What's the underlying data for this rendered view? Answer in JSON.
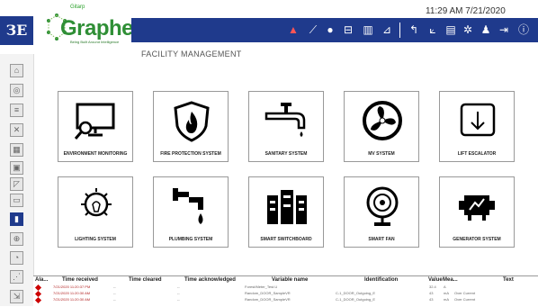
{
  "header": {
    "logo_text": "ЗЕ",
    "brand_small": "Gitarp",
    "brand": "Graphene",
    "tagline": "Being Built Around Intelligence",
    "clock": "11:29 AM  7/21/2020",
    "page_title": "FACILITY MANAGEMENT"
  },
  "toolbar_icons": [
    "alarm-bell-icon",
    "trend-chart-icon",
    "clock-icon",
    "server-icon",
    "bar-chart-icon",
    "report-chart-icon",
    "undo-icon",
    "line-chart-icon",
    "document-icon",
    "settings-gear-icon",
    "user-icon",
    "export-icon",
    "info-icon"
  ],
  "sidebar_icons": [
    "home-icon",
    "globe-icon",
    "document-icon",
    "tools-icon",
    "building-icon",
    "floorplan-icon",
    "escalator-icon",
    "keyboard-icon",
    "panel-icon",
    "search-zoom-icon",
    "meter-icon",
    "chart-icon",
    "logout-icon"
  ],
  "tiles": [
    {
      "label": "ENVIRONMENT MONITORING",
      "icon": "monitor-magnifier-icon"
    },
    {
      "label": "FIRE PROTECTION SYSTEM",
      "icon": "fire-shield-icon"
    },
    {
      "label": "SANITARY SYSTEM",
      "icon": "faucet-icon"
    },
    {
      "label": "MV SYSTEM",
      "icon": "fan-icon"
    },
    {
      "label": "LIFT ESCALATOR",
      "icon": "lift-down-arrow-icon"
    },
    {
      "label": "LIGHTING SYSTEM",
      "icon": "lightbulb-icon"
    },
    {
      "label": "PLUMBING SYSTEM",
      "icon": "pipe-drop-icon"
    },
    {
      "label": "SMART SWITCHBOARD",
      "icon": "switchboard-icon"
    },
    {
      "label": "SMART FAN",
      "icon": "desk-fan-icon"
    },
    {
      "label": "GENERATOR SYSTEM",
      "icon": "generator-icon"
    }
  ],
  "alarm_table": {
    "headers": [
      "Ala...",
      "Time received",
      "Time cleared",
      "Time acknowledged",
      "Variable name",
      "Identification",
      "Value",
      "Mea...",
      "Text"
    ],
    "rows": [
      [
        "",
        "7/21/2020 11:20:37 PM",
        "--",
        "--",
        "Forest/Meter_Test.U",
        "",
        "32.4",
        "A",
        ""
      ],
      [
        "",
        "7/21/2020 11:20:30 AM",
        "--",
        "--",
        "Random_DOOR_SampleVR",
        "C-1_DOOR_Outgoing_E",
        "43",
        "mA",
        "Over Current"
      ],
      [
        "",
        "7/21/2020 11:20:30 AM",
        "--",
        "--",
        "Random_DOOR_SampleVR",
        "C-1_DOOR_Outgoing_E",
        "43",
        "mA",
        "Over Current"
      ]
    ]
  },
  "colors": {
    "toolbar": "#1f3a8c",
    "brand": "#2f8f36",
    "alarm_text": "#b22222"
  }
}
